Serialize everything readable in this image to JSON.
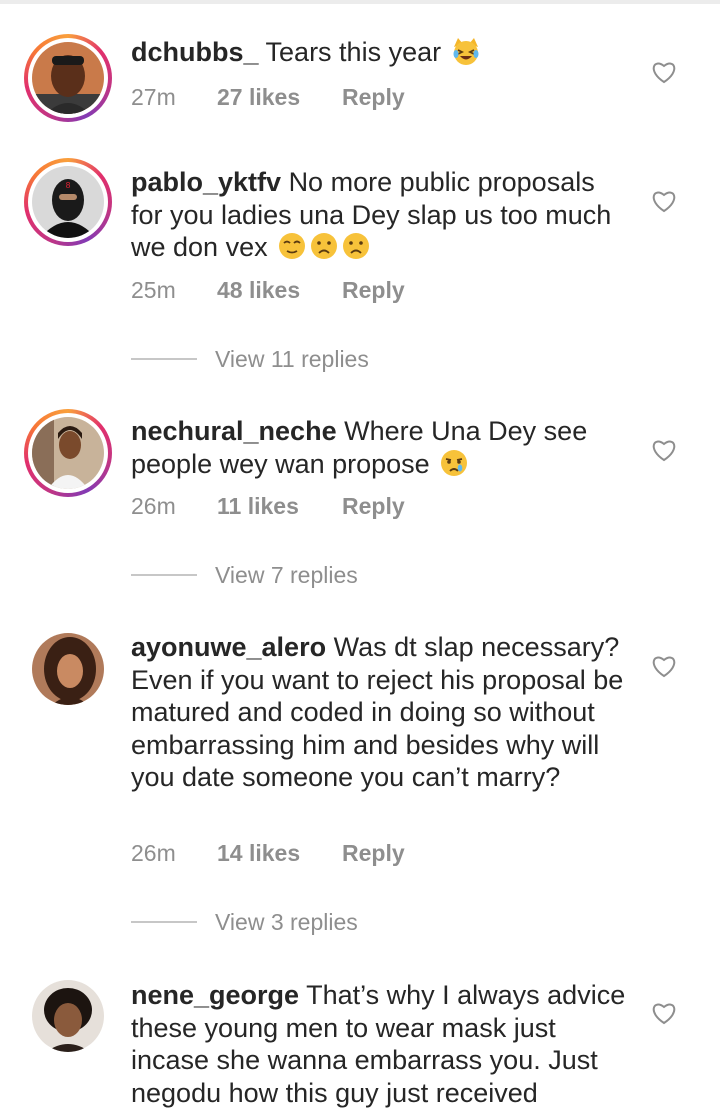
{
  "comments": [
    {
      "username": "dchubbs_",
      "text": "Tears this year",
      "emoji": [
        "laughing-crying-cat-face"
      ],
      "time": "27m",
      "likes": "27 likes",
      "reply": "Reply"
    },
    {
      "username": "pablo_yktfv",
      "text": "No more public proposals for you ladies una Dey slap us too much we don vex",
      "emoji": [
        "relieved-face",
        "frowning-face",
        "frowning-face"
      ],
      "time": "25m",
      "likes": "48 likes",
      "reply": "Reply",
      "view_replies": "View 11 replies"
    },
    {
      "username": "nechural_neche",
      "text": "Where Una Dey see people wey wan propose",
      "emoji": [
        "crying-face"
      ],
      "time": "26m",
      "likes": "11 likes",
      "reply": "Reply",
      "view_replies": "View 7 replies"
    },
    {
      "username": "ayonuwe_alero",
      "text": "Was dt slap necessary? Even if you want to reject his proposal be matured and coded in doing so without embarrassing him and besides why will you date someone you can’t marry?",
      "time": "26m",
      "likes": "14 likes",
      "reply": "Reply",
      "view_replies": "View 3 replies"
    },
    {
      "username": "nene_george",
      "text": "That’s why I always advice these young men to wear mask just incase she wanna embarrass you. Just negodu how this guy just received"
    }
  ],
  "colors": {
    "text": "#262626",
    "meta": "#8e8e8e",
    "story_ring_start": "#f9a03c",
    "story_ring_end": "#c13584"
  }
}
